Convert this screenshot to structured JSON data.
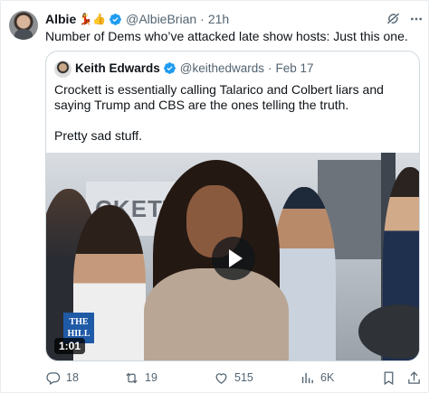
{
  "tweet": {
    "author_name": "Albie",
    "author_emoji": "💃👍",
    "author_handle": "@AlbieBrian",
    "separator": "·",
    "time": "21h",
    "text": "Number of Dems who’ve attacked late show hosts: Just this one."
  },
  "quoted": {
    "author_name": "Keith Edwards",
    "author_handle": "@keithedwards",
    "separator": "·",
    "time": "Feb 17",
    "paragraph_1": "Crockett is essentially calling Talarico and Colbert liars and saying Trump and CBS are the ones telling the truth.",
    "paragraph_2": "Pretty sad stuff.",
    "video": {
      "duration": "1:01",
      "logo_text_1": "THE",
      "logo_text_2": "HILL",
      "background_sign": "CKETT"
    }
  },
  "actions": {
    "replies": "18",
    "reposts": "19",
    "likes": "515",
    "views": "6K"
  },
  "colors": {
    "verified": "#1d9bf0",
    "muted_text": "#536471",
    "border": "#cfd9de"
  }
}
